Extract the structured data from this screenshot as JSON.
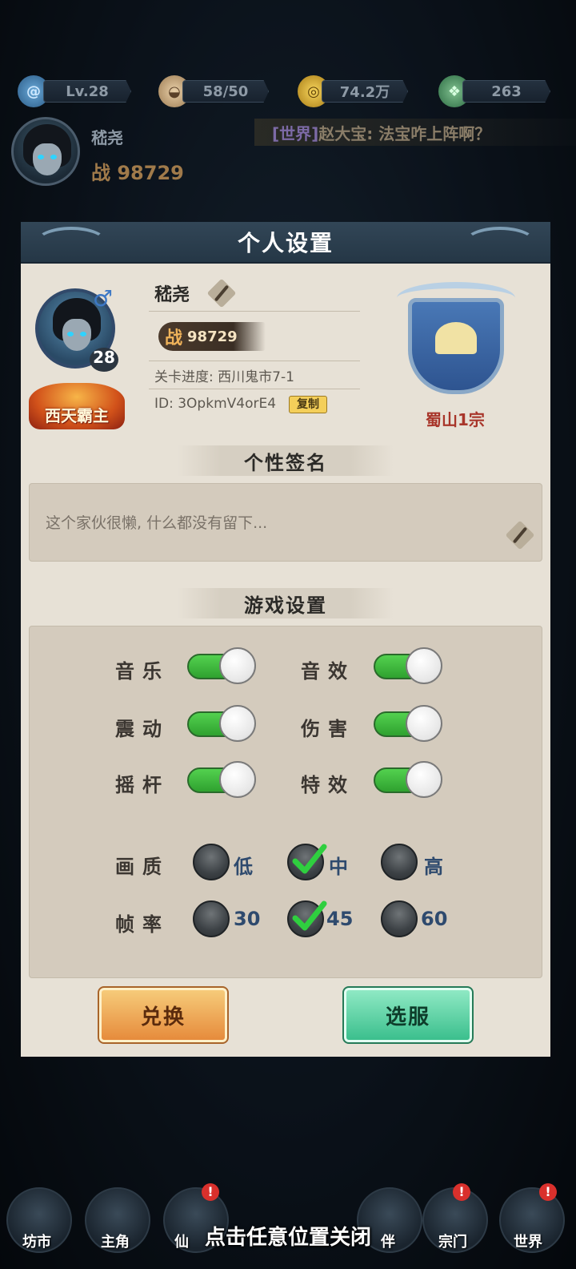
{
  "resources": {
    "level": "Lv.28",
    "stamina": "58/50",
    "coins": "74.2万",
    "jade": "263"
  },
  "player": {
    "name": "嵇尧",
    "power_label": "战",
    "power": "98729"
  },
  "chat": {
    "channel": "[世界]",
    "message": "赵大宝: 法宝咋上阵啊？"
  },
  "dialog": {
    "title": "个人设置",
    "profile": {
      "name": "嵇尧",
      "level": "28",
      "gender_symbol": "♂",
      "title_badge": "西天霸主",
      "power_label": "战",
      "power": "98729",
      "stage_progress": "关卡进度: 西川鬼市7-1",
      "id_text": "ID: 3OpkmV4orE4",
      "copy_label": "复制",
      "sect_name": "蜀山1宗"
    },
    "signature": {
      "heading": "个性签名",
      "text": "这个家伙很懒, 什么都没有留下..."
    },
    "game_settings": {
      "heading": "游戏设置",
      "toggles": [
        {
          "label": "音乐",
          "on": true
        },
        {
          "label": "音效",
          "on": true
        },
        {
          "label": "震动",
          "on": true
        },
        {
          "label": "伤害",
          "on": true
        },
        {
          "label": "摇杆",
          "on": true
        },
        {
          "label": "特效",
          "on": true
        }
      ],
      "quality": {
        "label": "画质",
        "options": [
          "低",
          "中",
          "高"
        ],
        "selected": "中"
      },
      "framerate": {
        "label": "帧率",
        "options": [
          "30",
          "45",
          "60"
        ],
        "selected": "45"
      }
    },
    "buttons": {
      "exchange": "兑换",
      "select_server": "选服"
    }
  },
  "bottom_nav": [
    {
      "label": "坊市",
      "badge": ""
    },
    {
      "label": "主角",
      "badge": ""
    },
    {
      "label": "仙",
      "badge": "!"
    },
    {
      "label": "伴",
      "badge": ""
    },
    {
      "label": "宗门",
      "badge": "!"
    },
    {
      "label": "世界",
      "badge": "!"
    }
  ],
  "close_hint": "点击任意位置关闭",
  "colors": {
    "toggle_on": "#3fbf3f",
    "sect_name": "#a8352a",
    "header_bg": "#2b3e4f",
    "dialog_bg": "#e7e1d6"
  },
  "icons": {
    "level": "swirl-icon",
    "stamina": "bun-icon",
    "coins": "coin-icon",
    "jade": "jade-icon"
  }
}
